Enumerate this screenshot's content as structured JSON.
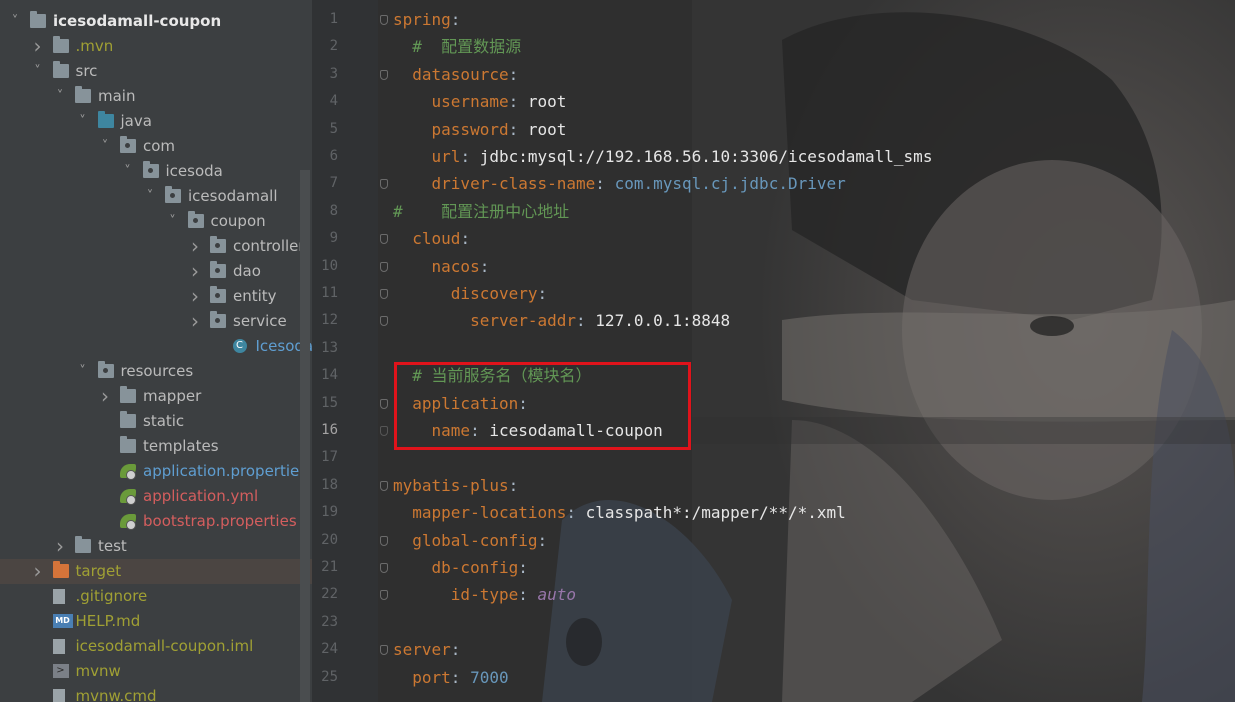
{
  "project_tree": {
    "items": [
      {
        "label": "icesodamall-coupon",
        "depth": 0,
        "chevron": "down",
        "icon": "folder-icon",
        "color": "#e8e8e8",
        "bold": true
      },
      {
        "label": ".mvn",
        "depth": 1,
        "chevron": "right",
        "icon": "folder-icon",
        "color": "#a0a034"
      },
      {
        "label": "src",
        "depth": 1,
        "chevron": "down",
        "icon": "folder-icon",
        "color": "#bbbbbb"
      },
      {
        "label": "main",
        "depth": 2,
        "chevron": "down",
        "icon": "folder-icon",
        "color": "#bbbbbb"
      },
      {
        "label": "java",
        "depth": 3,
        "chevron": "down",
        "icon": "folder-icon-blue",
        "color": "#bbbbbb"
      },
      {
        "label": "com",
        "depth": 4,
        "chevron": "down",
        "icon": "package-icon",
        "color": "#bbbbbb"
      },
      {
        "label": "icesoda",
        "depth": 5,
        "chevron": "down",
        "icon": "package-icon",
        "color": "#bbbbbb"
      },
      {
        "label": "icesodamall",
        "depth": 6,
        "chevron": "down",
        "icon": "package-icon",
        "color": "#bbbbbb"
      },
      {
        "label": "coupon",
        "depth": 7,
        "chevron": "down",
        "icon": "package-icon",
        "color": "#bbbbbb"
      },
      {
        "label": "controller",
        "depth": 8,
        "chevron": "right",
        "icon": "package-icon",
        "color": "#bbbbbb"
      },
      {
        "label": "dao",
        "depth": 8,
        "chevron": "right",
        "icon": "package-icon",
        "color": "#bbbbbb"
      },
      {
        "label": "entity",
        "depth": 8,
        "chevron": "right",
        "icon": "package-icon",
        "color": "#bbbbbb"
      },
      {
        "label": "service",
        "depth": 8,
        "chevron": "right",
        "icon": "package-icon",
        "color": "#bbbbbb"
      },
      {
        "label": "Icesodama",
        "depth": 9,
        "chevron": "",
        "icon": "spring-class-icon",
        "color": "#5f9ed1"
      },
      {
        "label": "resources",
        "depth": 3,
        "chevron": "down",
        "icon": "resources-folder-icon",
        "color": "#bbbbbb"
      },
      {
        "label": "mapper",
        "depth": 4,
        "chevron": "right",
        "icon": "folder-icon",
        "color": "#bbbbbb"
      },
      {
        "label": "static",
        "depth": 4,
        "chevron": "",
        "icon": "folder-icon",
        "color": "#bbbbbb"
      },
      {
        "label": "templates",
        "depth": 4,
        "chevron": "",
        "icon": "folder-icon",
        "color": "#bbbbbb"
      },
      {
        "label": "application.properties",
        "depth": 4,
        "chevron": "",
        "icon": "spring-config-icon",
        "color": "#5f9ed1"
      },
      {
        "label": "application.yml",
        "depth": 4,
        "chevron": "",
        "icon": "spring-config-icon",
        "color": "#d45e5e"
      },
      {
        "label": "bootstrap.properties",
        "depth": 4,
        "chevron": "",
        "icon": "spring-leaf-icon",
        "color": "#d45e5e"
      },
      {
        "label": "test",
        "depth": 2,
        "chevron": "right",
        "icon": "folder-icon",
        "color": "#bbbbbb"
      },
      {
        "label": "target",
        "depth": 1,
        "chevron": "right",
        "icon": "folder-icon-orange",
        "color": "#a0a034",
        "selected": true
      },
      {
        "label": ".gitignore",
        "depth": 1,
        "chevron": "",
        "icon": "file-icon",
        "color": "#a0a034"
      },
      {
        "label": "HELP.md",
        "depth": 1,
        "chevron": "",
        "icon": "markdown-icon",
        "color": "#a0a034"
      },
      {
        "label": "icesodamall-coupon.iml",
        "depth": 1,
        "chevron": "",
        "icon": "file-icon",
        "color": "#a0a034"
      },
      {
        "label": "mvnw",
        "depth": 1,
        "chevron": "",
        "icon": "terminal-icon",
        "color": "#a0a034"
      },
      {
        "label": "mvnw.cmd",
        "depth": 1,
        "chevron": "",
        "icon": "file-icon",
        "color": "#a0a034"
      }
    ]
  },
  "editor": {
    "current_line": "16",
    "lines": [
      {
        "num": "1",
        "fold": true,
        "segs": [
          [
            "k",
            "spring"
          ],
          [
            "t",
            ":"
          ]
        ]
      },
      {
        "num": "2",
        "segs": [
          [
            "t",
            "  "
          ],
          [
            "c",
            "#  配置数据源"
          ]
        ]
      },
      {
        "num": "3",
        "fold": true,
        "segs": [
          [
            "t",
            "  "
          ],
          [
            "k",
            "datasource"
          ],
          [
            "t",
            ":"
          ]
        ]
      },
      {
        "num": "4",
        "segs": [
          [
            "t",
            "    "
          ],
          [
            "k",
            "username"
          ],
          [
            "t",
            ": "
          ],
          [
            "v",
            "root"
          ]
        ]
      },
      {
        "num": "5",
        "segs": [
          [
            "t",
            "    "
          ],
          [
            "k",
            "password"
          ],
          [
            "t",
            ": "
          ],
          [
            "v",
            "root"
          ]
        ]
      },
      {
        "num": "6",
        "segs": [
          [
            "t",
            "    "
          ],
          [
            "k",
            "url"
          ],
          [
            "t",
            ": "
          ],
          [
            "v",
            "jdbc:mysql://192.168.56.10:3306/icesodamall_sms"
          ]
        ]
      },
      {
        "num": "7",
        "fold": true,
        "segs": [
          [
            "t",
            "    "
          ],
          [
            "k",
            "driver-class-name"
          ],
          [
            "t",
            ": "
          ],
          [
            "n",
            "com.mysql.cj.jdbc.Driver"
          ]
        ]
      },
      {
        "num": "8",
        "segs": [
          [
            "c",
            "#    配置注册中心地址"
          ]
        ]
      },
      {
        "num": "9",
        "fold": true,
        "segs": [
          [
            "t",
            "  "
          ],
          [
            "k",
            "cloud"
          ],
          [
            "t",
            ":"
          ]
        ]
      },
      {
        "num": "10",
        "fold": true,
        "segs": [
          [
            "t",
            "    "
          ],
          [
            "k",
            "nacos"
          ],
          [
            "t",
            ":"
          ]
        ]
      },
      {
        "num": "11",
        "fold": true,
        "segs": [
          [
            "t",
            "      "
          ],
          [
            "k",
            "discovery"
          ],
          [
            "t",
            ":"
          ]
        ]
      },
      {
        "num": "12",
        "fold": true,
        "segs": [
          [
            "t",
            "        "
          ],
          [
            "k",
            "server-addr"
          ],
          [
            "t",
            ": "
          ],
          [
            "v",
            "127.0.0.1:8848"
          ]
        ]
      },
      {
        "num": "13",
        "segs": []
      },
      {
        "num": "14",
        "segs": [
          [
            "t",
            "  "
          ],
          [
            "c",
            "# 当前服务名（模块名）"
          ]
        ]
      },
      {
        "num": "15",
        "fold": true,
        "segs": [
          [
            "t",
            "  "
          ],
          [
            "k",
            "application"
          ],
          [
            "t",
            ":"
          ]
        ]
      },
      {
        "num": "16",
        "fold": true,
        "segs": [
          [
            "t",
            "    "
          ],
          [
            "k",
            "name"
          ],
          [
            "t",
            ": "
          ],
          [
            "v",
            "icesodamall-coupon"
          ]
        ]
      },
      {
        "num": "17",
        "segs": []
      },
      {
        "num": "18",
        "fold": true,
        "segs": [
          [
            "k",
            "mybatis-plus"
          ],
          [
            "t",
            ":"
          ]
        ]
      },
      {
        "num": "19",
        "segs": [
          [
            "t",
            "  "
          ],
          [
            "k",
            "mapper-locations"
          ],
          [
            "t",
            ": "
          ],
          [
            "v",
            "classpath*:/mapper/**/*.xml"
          ]
        ]
      },
      {
        "num": "20",
        "fold": true,
        "segs": [
          [
            "t",
            "  "
          ],
          [
            "k",
            "global-config"
          ],
          [
            "t",
            ":"
          ]
        ]
      },
      {
        "num": "21",
        "fold": true,
        "segs": [
          [
            "t",
            "    "
          ],
          [
            "k",
            "db-config"
          ],
          [
            "t",
            ":"
          ]
        ]
      },
      {
        "num": "22",
        "fold": true,
        "segs": [
          [
            "t",
            "      "
          ],
          [
            "k",
            "id-type"
          ],
          [
            "t",
            ": "
          ],
          [
            "i",
            "auto"
          ]
        ]
      },
      {
        "num": "23",
        "segs": []
      },
      {
        "num": "24",
        "fold": true,
        "segs": [
          [
            "k",
            "server"
          ],
          [
            "t",
            ":"
          ]
        ]
      },
      {
        "num": "25",
        "segs": [
          [
            "t",
            "  "
          ],
          [
            "k",
            "port"
          ],
          [
            "t",
            ": "
          ],
          [
            "n",
            "7000"
          ]
        ]
      }
    ]
  }
}
